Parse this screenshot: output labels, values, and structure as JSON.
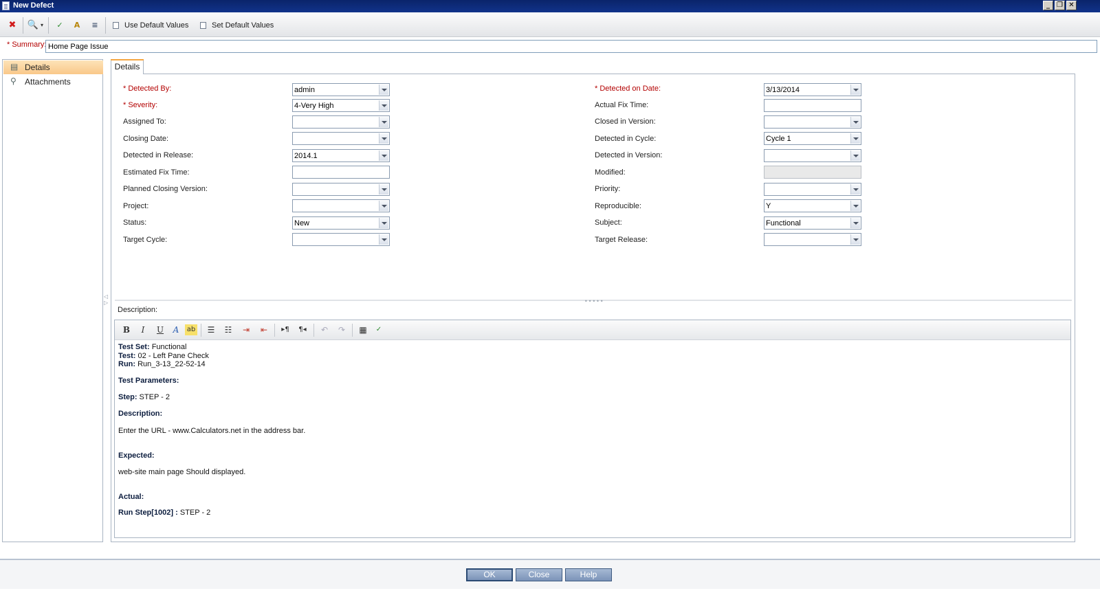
{
  "window": {
    "title": "New Defect"
  },
  "toolbar": {
    "icons": [
      "delete-icon",
      "find-icon",
      "spell-check-icon",
      "thesaurus-icon",
      "spelling-options-icon"
    ],
    "use_default_label": "Use Default Values",
    "set_default_label": "Set Default Values"
  },
  "summary": {
    "label": "* Summary:",
    "value": "Home Page Issue"
  },
  "nav": {
    "details": "Details",
    "attachments": "Attachments"
  },
  "tab": {
    "label": "Details"
  },
  "fields_left": [
    {
      "label": "* Detected By:",
      "value": "admin",
      "required": true
    },
    {
      "label": "* Severity:",
      "value": "4-Very High",
      "required": true
    },
    {
      "label": "Assigned To:",
      "value": ""
    },
    {
      "label": "Closing Date:",
      "value": ""
    },
    {
      "label": "Detected in Release:",
      "value": "2014.1"
    },
    {
      "label": "Estimated Fix Time:",
      "value": ""
    },
    {
      "label": "Planned Closing Version:",
      "value": ""
    },
    {
      "label": "Project:",
      "value": ""
    },
    {
      "label": "Status:",
      "value": "New"
    },
    {
      "label": "Target Cycle:",
      "value": ""
    }
  ],
  "fields_right": [
    {
      "label": "* Detected on Date:",
      "value": "3/13/2014",
      "required": true
    },
    {
      "label": "Actual Fix Time:",
      "value": ""
    },
    {
      "label": "Closed in Version:",
      "value": ""
    },
    {
      "label": "Detected in Cycle:",
      "value": "Cycle 1"
    },
    {
      "label": "Detected in Version:",
      "value": ""
    },
    {
      "label": "Modified:",
      "value": ""
    },
    {
      "label": "Priority:",
      "value": ""
    },
    {
      "label": "Reproducible:",
      "value": "Y"
    },
    {
      "label": "Subject:",
      "value": "Functional"
    },
    {
      "label": "Target Release:",
      "value": ""
    }
  ],
  "description": {
    "label": "Description:",
    "editor_icons": [
      "bold-icon",
      "italic-icon",
      "underline-icon",
      "font-color-icon",
      "highlight-icon",
      "bullet-list-icon",
      "numbered-list-icon",
      "indent-icon",
      "outdent-icon",
      "ltr-icon",
      "rtl-icon",
      "undo-icon",
      "redo-icon",
      "table-icon",
      "spell-check-icon"
    ],
    "lines": {
      "test_set_label": "Test Set:",
      "test_set_value": " Functional",
      "test_label": "Test:",
      "test_value": " 02 - Left Pane Check",
      "run_label": "Run:",
      "run_value": " Run_3-13_22-52-14",
      "params_label": "Test Parameters:",
      "step_label": "Step:",
      "step_value": " STEP - 2",
      "desc_label": "Description:",
      "desc_value": "Enter the URL - www.Calculators.net in the address bar.",
      "expected_label": "Expected:",
      "expected_value": "web-site main page Should displayed.",
      "actual_label": "Actual:",
      "run_step_label": "Run Step[1002] :",
      "run_step_value": " STEP - 2"
    }
  },
  "footer": {
    "ok": "OK",
    "close": "Close",
    "help": "Help"
  }
}
